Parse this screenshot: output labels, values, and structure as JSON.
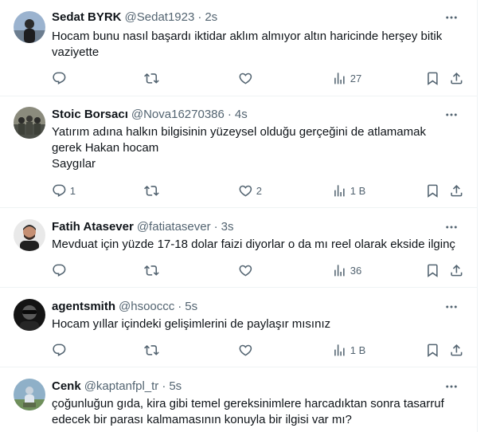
{
  "tweets": [
    {
      "name": "Sedat BYRK",
      "handle": "@Sedat1923",
      "time": "2s",
      "text": [
        "Hocam bunu nasıl başardı iktidar aklım almıyor altın haricinde herşey bitik",
        "vaziyette"
      ],
      "reply_count": "",
      "retweet_count": "",
      "like_count": "",
      "view_count": "27"
    },
    {
      "name": "Stoic Borsacı",
      "handle": "@Nova16270386",
      "time": "4s",
      "text": [
        "Yatırım adına halkın bilgisinin yüzeysel olduğu gerçeğini de atlamamak",
        "gerek Hakan hocam",
        "Saygılar"
      ],
      "reply_count": "1",
      "retweet_count": "",
      "like_count": "2",
      "view_count": "1 B"
    },
    {
      "name": "Fatih Atasever",
      "handle": "@fatiatasever",
      "time": "3s",
      "text": [
        "Mevduat için yüzde 17-18 dolar faizi diyorlar o da mı reel olarak ekside ilginç"
      ],
      "reply_count": "",
      "retweet_count": "",
      "like_count": "",
      "view_count": "36"
    },
    {
      "name": "agentsmith",
      "handle": "@hsooccc",
      "time": "5s",
      "text": [
        "Hocam yıllar içindeki gelişimlerini de paylaşır mısınız"
      ],
      "reply_count": "",
      "retweet_count": "",
      "like_count": "",
      "view_count": "1 B"
    },
    {
      "name": "Cenk",
      "handle": "@kaptanfpl_tr",
      "time": "5s",
      "text": [
        "çoğunluğun gıda, kira gibi temel gereksinimlere harcadıktan sonra tasarruf",
        "edecek bir parası kalmamasının konuyla bir ilgisi var mı?"
      ],
      "reply_count": "",
      "retweet_count": "",
      "like_count": "",
      "view_count": ""
    }
  ],
  "icons": {
    "more": "more-horizontal-icon",
    "reply": "reply-bubble-icon",
    "retweet": "retweet-arrows-icon",
    "like": "heart-icon",
    "views": "bar-chart-icon",
    "bookmark": "bookmark-icon",
    "share": "share-upload-icon"
  },
  "colors": {
    "text_primary": "#0f1419",
    "text_secondary": "#536471",
    "divider": "#eff3f4"
  }
}
